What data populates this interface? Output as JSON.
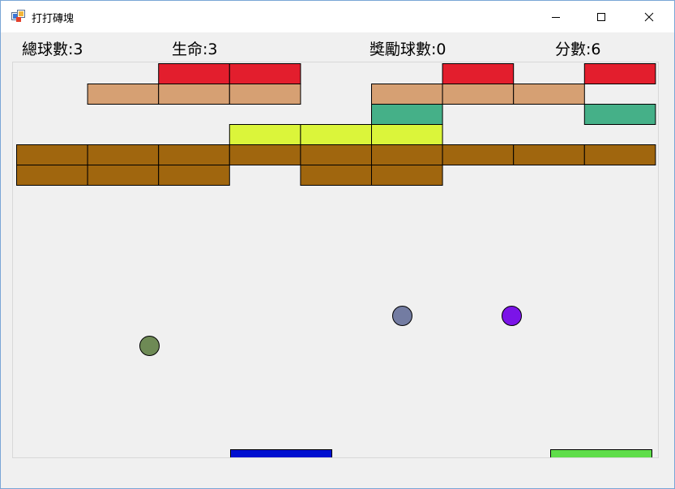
{
  "window": {
    "title": "打打磚塊",
    "icon": "windows-app-icon",
    "buttons": [
      "minimize-icon",
      "maximize-icon",
      "close-icon"
    ]
  },
  "hud": {
    "total_balls": "總球數:3",
    "lives": "生命:3",
    "bonus_balls": "獎勵球數:0",
    "score": "分數:6"
  },
  "colors": {
    "red": "#e31e2d",
    "tan": "#d6a073",
    "teal": "#45b088",
    "yellow": "#dbf53a",
    "brown": "#a0660e",
    "border": "#000000",
    "background": "#f0f0f0"
  },
  "bricks": [
    {
      "col": 2,
      "row": 0,
      "color": "#e31e2d"
    },
    {
      "col": 3,
      "row": 0,
      "color": "#e31e2d"
    },
    {
      "col": 6,
      "row": 0,
      "color": "#e31e2d"
    },
    {
      "col": 8,
      "row": 0,
      "color": "#e31e2d"
    },
    {
      "col": 1,
      "row": 1,
      "color": "#d6a073"
    },
    {
      "col": 2,
      "row": 1,
      "color": "#d6a073"
    },
    {
      "col": 3,
      "row": 1,
      "color": "#d6a073"
    },
    {
      "col": 5,
      "row": 1,
      "color": "#d6a073"
    },
    {
      "col": 6,
      "row": 1,
      "color": "#d6a073"
    },
    {
      "col": 7,
      "row": 1,
      "color": "#d6a073"
    },
    {
      "col": 5,
      "row": 2,
      "color": "#45b088"
    },
    {
      "col": 8,
      "row": 2,
      "color": "#45b088"
    },
    {
      "col": 3,
      "row": 3,
      "color": "#dbf53a"
    },
    {
      "col": 4,
      "row": 3,
      "color": "#dbf53a"
    },
    {
      "col": 5,
      "row": 3,
      "color": "#dbf53a"
    },
    {
      "col": 0,
      "row": 4,
      "color": "#a0660e"
    },
    {
      "col": 1,
      "row": 4,
      "color": "#a0660e"
    },
    {
      "col": 2,
      "row": 4,
      "color": "#a0660e"
    },
    {
      "col": 3,
      "row": 4,
      "color": "#a0660e"
    },
    {
      "col": 4,
      "row": 4,
      "color": "#a0660e"
    },
    {
      "col": 5,
      "row": 4,
      "color": "#a0660e"
    },
    {
      "col": 6,
      "row": 4,
      "color": "#a0660e"
    },
    {
      "col": 7,
      "row": 4,
      "color": "#a0660e"
    },
    {
      "col": 8,
      "row": 4,
      "color": "#a0660e"
    },
    {
      "col": 0,
      "row": 5,
      "color": "#a0660e"
    },
    {
      "col": 1,
      "row": 5,
      "color": "#a0660e"
    },
    {
      "col": 2,
      "row": 5,
      "color": "#a0660e"
    },
    {
      "col": 4,
      "row": 5,
      "color": "#a0660e"
    },
    {
      "col": 5,
      "row": 5,
      "color": "#a0660e"
    }
  ],
  "balls": [
    {
      "name": "ball-green",
      "color": "#6e8a55"
    },
    {
      "name": "ball-slate",
      "color": "#737ca2"
    },
    {
      "name": "ball-purple",
      "color": "#7b14e8"
    }
  ],
  "paddles": [
    {
      "name": "paddle-blue",
      "color": "#0010d0"
    },
    {
      "name": "paddle-green",
      "color": "#5fdd4a"
    }
  ]
}
